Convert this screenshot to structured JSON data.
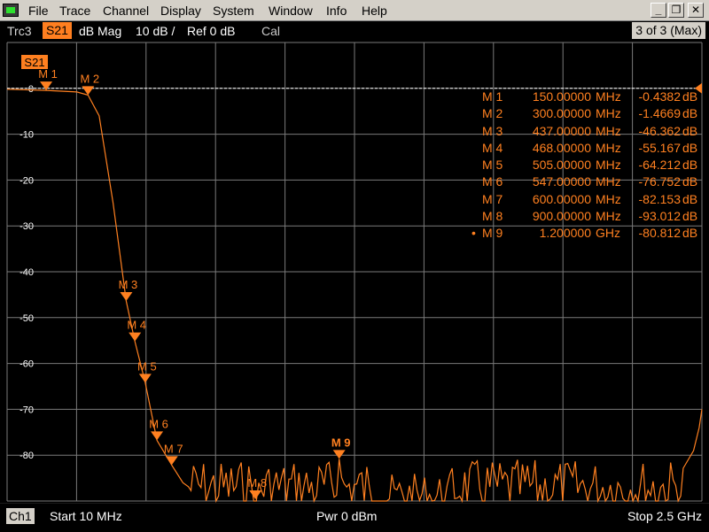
{
  "menu": [
    "File",
    "Trace",
    "Channel",
    "Display",
    "System",
    "Window",
    "Info",
    "Help"
  ],
  "window_buttons": {
    "minimize": "_",
    "restore": "❐",
    "close": "✕"
  },
  "trace_header": {
    "name": "Trc3",
    "param": "S21",
    "format": "dB Mag",
    "scale": "10 dB /",
    "ref": "Ref 0 dB",
    "cal": "Cal",
    "count": "3 of 3 (Max)"
  },
  "plot": {
    "trace_label": "S21",
    "y_ticks": [
      "0",
      "-10",
      "-20",
      "-30",
      "-40",
      "-50",
      "-60",
      "-70",
      "-80"
    ],
    "y_range_db": [
      -90,
      10
    ],
    "x_range_mhz": [
      10,
      2500
    ],
    "trace_color": "#ff8020",
    "grid_color": "#7a7a7a"
  },
  "markers": [
    {
      "name": "M 1",
      "freq": "150.00000",
      "unit": "MHz",
      "value": "-0.4382",
      "db_unit": "dB",
      "active": ""
    },
    {
      "name": "M 2",
      "freq": "300.00000",
      "unit": "MHz",
      "value": "-1.4669",
      "db_unit": "dB",
      "active": ""
    },
    {
      "name": "M 3",
      "freq": "437.00000",
      "unit": "MHz",
      "value": "-46.362",
      "db_unit": "dB",
      "active": ""
    },
    {
      "name": "M 4",
      "freq": "468.00000",
      "unit": "MHz",
      "value": "-55.167",
      "db_unit": "dB",
      "active": ""
    },
    {
      "name": "M 5",
      "freq": "505.00000",
      "unit": "MHz",
      "value": "-64.212",
      "db_unit": "dB",
      "active": ""
    },
    {
      "name": "M 6",
      "freq": "547.00000",
      "unit": "MHz",
      "value": "-76.752",
      "db_unit": "dB",
      "active": ""
    },
    {
      "name": "M 7",
      "freq": "600.00000",
      "unit": "MHz",
      "value": "-82.153",
      "db_unit": "dB",
      "active": ""
    },
    {
      "name": "M 8",
      "freq": "900.00000",
      "unit": "MHz",
      "value": "-93.012",
      "db_unit": "dB",
      "active": ""
    },
    {
      "name": "M 9",
      "freq": "1.200000",
      "unit": "GHz",
      "value": "-80.812",
      "db_unit": "dB",
      "active": "•"
    }
  ],
  "marker_plot": [
    {
      "label": "M 1",
      "freq_mhz": 150,
      "db": -0.4382,
      "bold": false
    },
    {
      "label": "M 2",
      "freq_mhz": 300,
      "db": -1.4669,
      "bold": false
    },
    {
      "label": "M 3",
      "freq_mhz": 437,
      "db": -46.362,
      "bold": false
    },
    {
      "label": "M 4",
      "freq_mhz": 468,
      "db": -55.167,
      "bold": false
    },
    {
      "label": "M 5",
      "freq_mhz": 505,
      "db": -64.212,
      "bold": false
    },
    {
      "label": "M 6",
      "freq_mhz": 547,
      "db": -76.752,
      "bold": false
    },
    {
      "label": "M 7",
      "freq_mhz": 600,
      "db": -82.153,
      "bold": false
    },
    {
      "label": "M 8",
      "freq_mhz": 900,
      "db": -93.012,
      "bold": false
    },
    {
      "label": "M 9",
      "freq_mhz": 1200,
      "db": -80.812,
      "bold": true
    }
  ],
  "status": {
    "channel": "Ch1",
    "start": "Start  10 MHz",
    "power": "Pwr  0 dBm",
    "stop": "Stop  2.5 GHz"
  }
}
